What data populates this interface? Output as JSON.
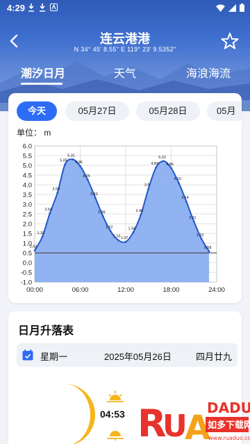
{
  "status_bar": {
    "time": "4:29"
  },
  "header": {
    "title": "连云港港",
    "coordinates": "N 34° 45' 8.55\"   E 119° 23' 9.5352\""
  },
  "tabs": [
    {
      "label": "潮汐日月",
      "active": true
    },
    {
      "label": "天气",
      "active": false
    },
    {
      "label": "海浪海流",
      "active": false
    }
  ],
  "date_chips": [
    {
      "label": "今天",
      "active": true
    },
    {
      "label": "05月27日",
      "active": false
    },
    {
      "label": "05月28日",
      "active": false
    },
    {
      "label": "05月",
      "active": false
    }
  ],
  "unit_label": "单位： m",
  "chart_data": {
    "type": "area",
    "x_tick_labels": [
      "00:00",
      "06:00",
      "12:00",
      "18:00",
      "24:00"
    ],
    "y_tick_labels": [
      "6.0",
      "5.5",
      "5.0",
      "4.5",
      "4.0",
      "3.5",
      "3.0",
      "2.5",
      "2.0",
      "1.5",
      "1.0",
      "0.5",
      "0.0",
      "-0.5",
      "-1.0"
    ],
    "ylim": [
      -1.0,
      6.0
    ],
    "xlim": [
      0,
      24
    ],
    "reference_line": 0.5,
    "series_color": "#2357c9",
    "fill_color": "#7fa6ee",
    "series": [
      {
        "x": [
          0,
          1,
          2,
          3,
          4,
          5,
          6,
          7,
          8,
          9,
          10,
          11,
          12,
          13,
          14,
          15,
          16,
          17,
          18,
          19,
          20,
          21,
          22,
          23
        ],
        "values": [
          0.62,
          1.33,
          2.54,
          3.59,
          5.05,
          5.31,
          4.96,
          4.25,
          3.33,
          2.39,
          1.62,
          1.16,
          1.07,
          1.56,
          2.46,
          3.8,
          4.89,
          5.22,
          4.86,
          4.1,
          3.14,
          2.11,
          1.22,
          0.58
        ]
      }
    ],
    "point_labels": [
      "0.62",
      "1.33",
      "2.54",
      "3.59",
      "5.05",
      "5.31",
      "4.96",
      "4.25",
      "3.33",
      "2.39",
      "1.62",
      "1.16",
      "1.07",
      "1.56",
      "2.46",
      "3.8",
      "4.89",
      "5.22",
      "4.86",
      "4.10",
      "3.14",
      "2.11",
      "1.22",
      "0.58"
    ]
  },
  "sun_moon": {
    "section_title": "日月升落表",
    "weekday": "星期一",
    "date": "2025年05月26日",
    "lunar": "四月廿九",
    "sunrise_time": "04:53"
  },
  "colors": {
    "accent": "#2e6cf5",
    "moon": "#f5b51b",
    "watermark_red": "#e8322b",
    "watermark_orange": "#f4a21b"
  }
}
